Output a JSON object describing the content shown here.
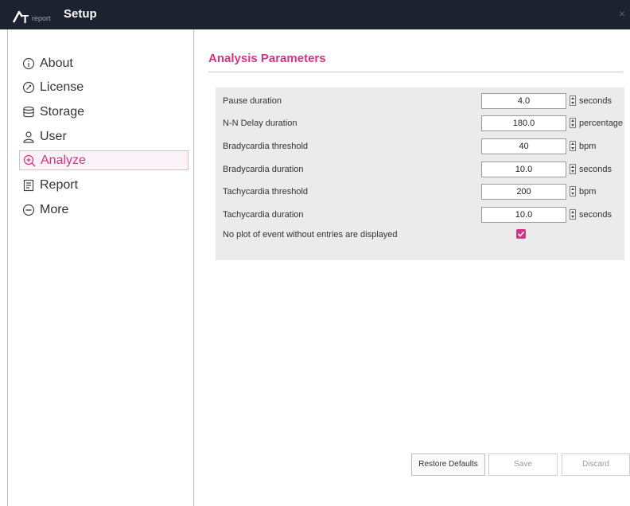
{
  "window": {
    "logo_letter": "T",
    "logo_sub": "report",
    "title": "Setup",
    "close_glyph": "×"
  },
  "sidebar": {
    "items": [
      {
        "label": "About",
        "icon": "info-icon"
      },
      {
        "label": "License",
        "icon": "license-icon"
      },
      {
        "label": "Storage",
        "icon": "database-icon"
      },
      {
        "label": "User",
        "icon": "user-icon"
      },
      {
        "label": "Analyze",
        "icon": "analyze-icon",
        "active": true
      },
      {
        "label": "Report",
        "icon": "report-icon"
      },
      {
        "label": "More",
        "icon": "more-icon"
      }
    ]
  },
  "main": {
    "section_title": "Analysis Parameters",
    "params": [
      {
        "label": "Pause duration",
        "value": "4.0",
        "unit": "seconds"
      },
      {
        "label": "N-N Delay duration",
        "value": "180.0",
        "unit": "percentage"
      },
      {
        "label": "Bradycardia threshold",
        "value": "40",
        "unit": "bpm"
      },
      {
        "label": "Bradycardia duration",
        "value": "10.0",
        "unit": "seconds"
      },
      {
        "label": "Tachycardia threshold",
        "value": "200",
        "unit": "bpm"
      },
      {
        "label": "Tachycardia duration",
        "value": "10.0",
        "unit": "seconds"
      }
    ],
    "checkbox": {
      "label": "No plot of event without entries are displayed",
      "checked": true
    }
  },
  "footer": {
    "restore_label": "Restore Defaults",
    "save_label": "Save",
    "discard_label": "Discard"
  },
  "colors": {
    "accent": "#d63384",
    "titlebar": "#1d2231",
    "panel": "#ebebeb"
  }
}
